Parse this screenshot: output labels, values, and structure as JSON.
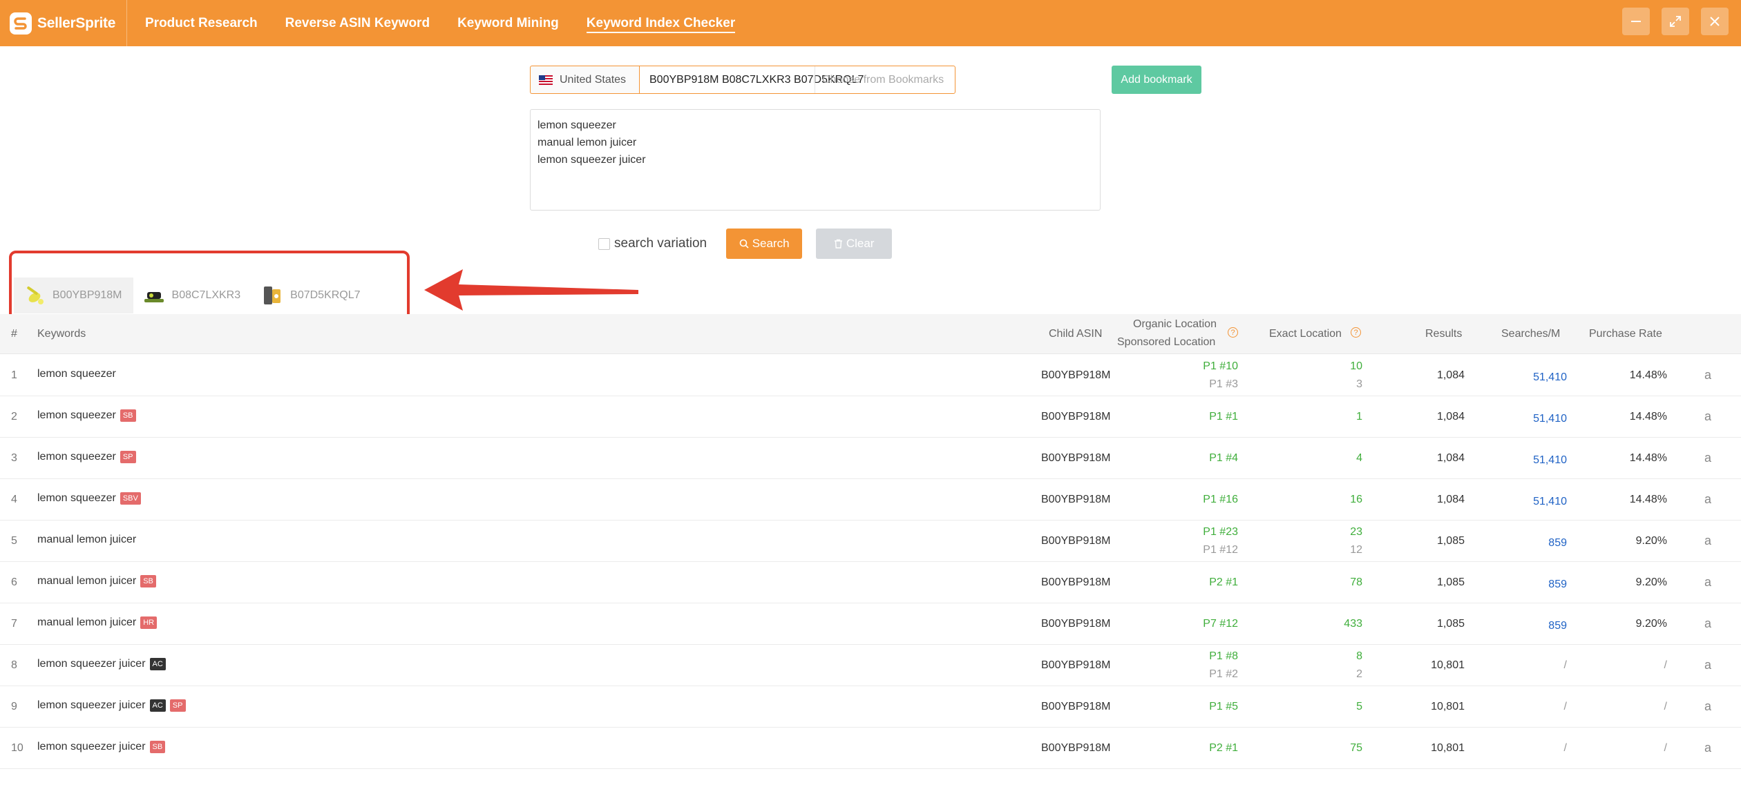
{
  "header": {
    "logo_text": "SellerSprite",
    "nav": [
      {
        "label": "Product Research"
      },
      {
        "label": "Reverse ASIN Keyword"
      },
      {
        "label": "Keyword Mining"
      },
      {
        "label": "Keyword Index Checker"
      }
    ],
    "accent_color": "#f39435"
  },
  "search": {
    "country": "United States",
    "asins_value": "B00YBP918M B08C7LXKR3 B07D5KRQL7",
    "bookmark_placeholder": "Choose from Bookmarks",
    "add_bookmark_label": "Add bookmark",
    "keywords": [
      "lemon squeezer",
      "manual lemon juicer",
      "lemon squeezer juicer"
    ],
    "variation_label": "search variation",
    "search_label": "Search",
    "clear_label": "Clear"
  },
  "asin_tabs": [
    {
      "label": "B00YBP918M",
      "active": true
    },
    {
      "label": "B08C7LXKR3",
      "active": false
    },
    {
      "label": "B07D5KRQL7",
      "active": false
    }
  ],
  "table": {
    "headers": {
      "index": "#",
      "keywords": "Keywords",
      "child_asin": "Child ASIN",
      "organic": "Organic Location",
      "sponsored": "Sponsored Location",
      "exact": "Exact Location",
      "results": "Results",
      "searches": "Searches/M",
      "purchase": "Purchase Rate"
    },
    "rows": [
      {
        "idx": "1",
        "kw": "lemon squeezer",
        "tags": [],
        "asin": "B00YBP918M",
        "loc1": "P1 #10",
        "loc2": "P1 #3",
        "ex1": "10",
        "ex2": "3",
        "results": "1,084",
        "searches": "51,410",
        "purchase": "14.48%"
      },
      {
        "idx": "2",
        "kw": "lemon squeezer",
        "tags": [
          "SB"
        ],
        "asin": "B00YBP918M",
        "loc1": "P1 #1",
        "loc2": "",
        "ex1": "1",
        "ex2": "",
        "results": "1,084",
        "searches": "51,410",
        "purchase": "14.48%"
      },
      {
        "idx": "3",
        "kw": "lemon squeezer",
        "tags": [
          "SP"
        ],
        "asin": "B00YBP918M",
        "loc1": "P1 #4",
        "loc2": "",
        "ex1": "4",
        "ex2": "",
        "results": "1,084",
        "searches": "51,410",
        "purchase": "14.48%"
      },
      {
        "idx": "4",
        "kw": "lemon squeezer",
        "tags": [
          "SBV"
        ],
        "asin": "B00YBP918M",
        "loc1": "P1 #16",
        "loc2": "",
        "ex1": "16",
        "ex2": "",
        "results": "1,084",
        "searches": "51,410",
        "purchase": "14.48%"
      },
      {
        "idx": "5",
        "kw": "manual lemon juicer",
        "tags": [],
        "asin": "B00YBP918M",
        "loc1": "P1 #23",
        "loc2": "P1 #12",
        "ex1": "23",
        "ex2": "12",
        "results": "1,085",
        "searches": "859",
        "purchase": "9.20%"
      },
      {
        "idx": "6",
        "kw": "manual lemon juicer",
        "tags": [
          "SB"
        ],
        "asin": "B00YBP918M",
        "loc1": "P2 #1",
        "loc2": "",
        "ex1": "78",
        "ex2": "",
        "results": "1,085",
        "searches": "859",
        "purchase": "9.20%"
      },
      {
        "idx": "7",
        "kw": "manual lemon juicer",
        "tags": [
          "HR"
        ],
        "asin": "B00YBP918M",
        "loc1": "P7 #12",
        "loc2": "",
        "ex1": "433",
        "ex2": "",
        "results": "1,085",
        "searches": "859",
        "purchase": "9.20%"
      },
      {
        "idx": "8",
        "kw": "lemon squeezer juicer",
        "tags": [
          "AC"
        ],
        "asin": "B00YBP918M",
        "loc1": "P1 #8",
        "loc2": "P1 #2",
        "ex1": "8",
        "ex2": "2",
        "results": "10,801",
        "searches": "/",
        "purchase": "/"
      },
      {
        "idx": "9",
        "kw": "lemon squeezer juicer",
        "tags": [
          "AC",
          "SP"
        ],
        "asin": "B00YBP918M",
        "loc1": "P1 #5",
        "loc2": "",
        "ex1": "5",
        "ex2": "",
        "results": "10,801",
        "searches": "/",
        "purchase": "/"
      },
      {
        "idx": "10",
        "kw": "lemon squeezer juicer",
        "tags": [
          "SB"
        ],
        "asin": "B00YBP918M",
        "loc1": "P2 #1",
        "loc2": "",
        "ex1": "75",
        "ex2": "",
        "results": "10,801",
        "searches": "/",
        "purchase": "/"
      }
    ],
    "amazon_icon": "a"
  }
}
